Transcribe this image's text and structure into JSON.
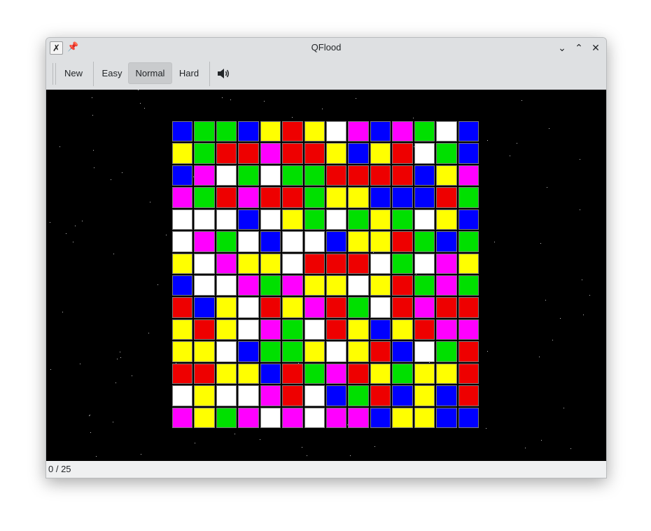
{
  "window": {
    "title": "QFlood"
  },
  "toolbar": {
    "new_label": "New",
    "easy_label": "Easy",
    "normal_label": "Normal",
    "hard_label": "Hard",
    "selected_difficulty": "Normal",
    "sound_icon": "speaker-icon"
  },
  "status": {
    "moves": "0 / 25"
  },
  "palette": {
    "B": "#0000ff",
    "G": "#00e000",
    "Y": "#ffff00",
    "R": "#ee0000",
    "W": "#ffffff",
    "M": "#ff00ff"
  },
  "board": {
    "size": 14,
    "rows": [
      "BGGBYRYWMBMGWB",
      "YGRRMRRYBYRWGB",
      "BMWGWGGRRRRBYM",
      "MGRMRRGYYBBBRG",
      "WWWBWYGWGYGWYB",
      "WMGWBWWBYYRGBG",
      "YWMYYWRRRWGWMY",
      "BWWMGMYYWYRGMG",
      "RBYWRYMRGWRMRR",
      "YRYWMGWRYBYRMM",
      "YYWBGGYWYRBWGR",
      "RRYYBRGMRYGYYR",
      "WYWWMRWBGRBYBR",
      "MYGMWMWMMBYYBB"
    ]
  }
}
